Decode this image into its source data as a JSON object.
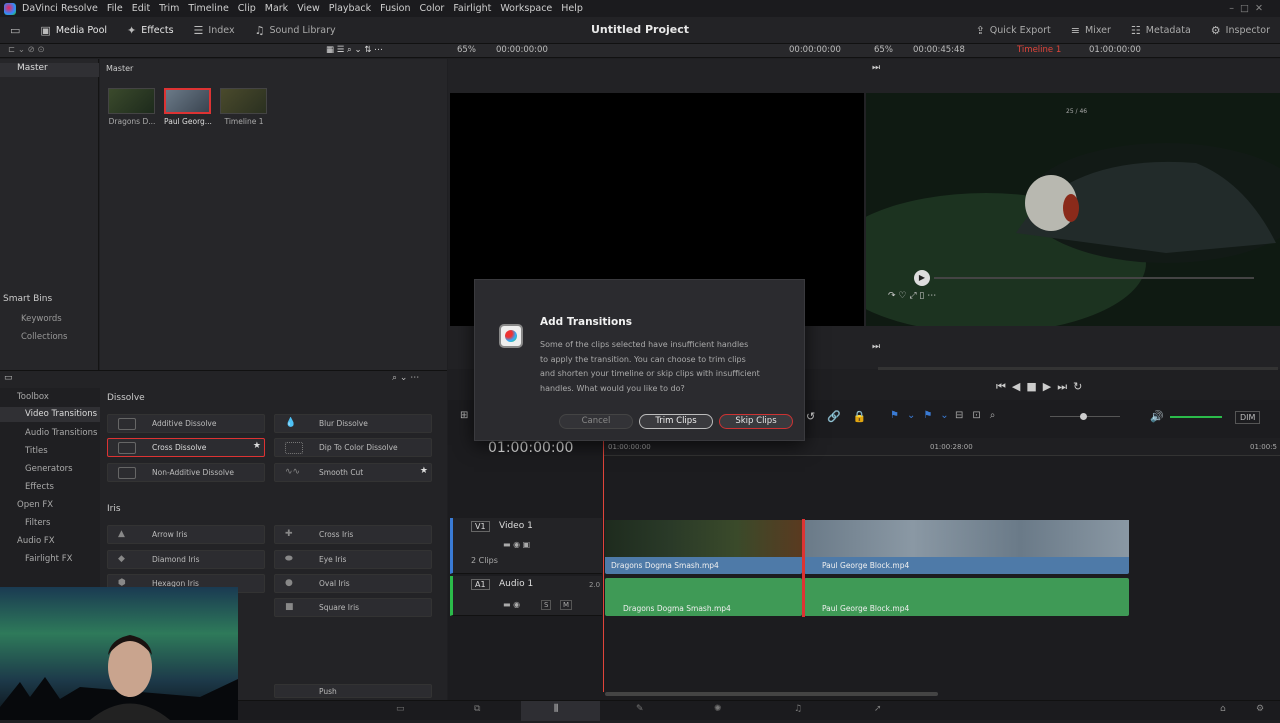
{
  "app": {
    "name": "DaVinci Resolve",
    "project_title": "Untitled Project"
  },
  "menu": [
    "File",
    "Edit",
    "Trim",
    "Timeline",
    "Clip",
    "Mark",
    "View",
    "Playback",
    "Fusion",
    "Color",
    "Fairlight",
    "Workspace",
    "Help"
  ],
  "toolbar_left": [
    "Media Pool",
    "Effects",
    "Index",
    "Sound Library"
  ],
  "toolbar_right": [
    "Quick Export",
    "Mixer",
    "Metadata",
    "Inspector"
  ],
  "viewer": {
    "left_zoom": "65%",
    "left_tc": "00:00:00:00",
    "right_tc_a": "00:00:00:00",
    "right_zoom": "65%",
    "right_tc_b": "00:00:45:48",
    "timeline_name": "Timeline 1",
    "timeline_tc": "01:00:00:00"
  },
  "bins": {
    "master": "Master",
    "smart_bins": "Smart Bins",
    "keywords": "Keywords",
    "collections": "Collections"
  },
  "pool": {
    "header": "Master",
    "clips": [
      "Dragons D...",
      "Paul Georg...",
      "Timeline 1"
    ]
  },
  "toolbox": {
    "items": [
      "Toolbox",
      "Video Transitions",
      "Audio Transitions",
      "Titles",
      "Generators",
      "Effects",
      "Open FX",
      "Filters",
      "Audio FX",
      "Fairlight FX"
    ],
    "dissolve_header": "Dissolve",
    "dissolves": [
      "Additive Dissolve",
      "Blur Dissolve",
      "Cross Dissolve",
      "Dip To Color Dissolve",
      "Non-Additive Dissolve",
      "Smooth Cut"
    ],
    "iris_header": "Iris",
    "iris": [
      "Arrow Iris",
      "Cross Iris",
      "Diamond Iris",
      "Eye Iris",
      "Hexagon Iris",
      "Oval Iris",
      "Square Iris"
    ],
    "push": "Push"
  },
  "dialog": {
    "title": "Add Transitions",
    "line1": "Some of the clips selected have insufficient handles",
    "line2": "to apply the transition. You can choose to trim clips",
    "line3": "and shorten your timeline or skip clips with insufficient",
    "line4": "handles. What would you like to do?",
    "cancel": "Cancel",
    "trim": "Trim Clips",
    "skip": "Skip Clips"
  },
  "timeline": {
    "timecode": "01:00:00:00",
    "ruler": [
      "01:00:00:00",
      "01:00:28:00",
      "01:00:5"
    ],
    "v1_tag": "V1",
    "v1_name": "Video 1",
    "v1_clips": "2 Clips",
    "a1_tag": "A1",
    "a1_name": "Audio 1",
    "a1_ch": "2.0",
    "clip1": "Dragons Dogma Smash.mp4",
    "clip2": "Paul George Block.mp4",
    "dim": "DIM",
    "s": "S",
    "m": "M"
  },
  "video_overlay": {
    "counter": "25 / 46"
  }
}
